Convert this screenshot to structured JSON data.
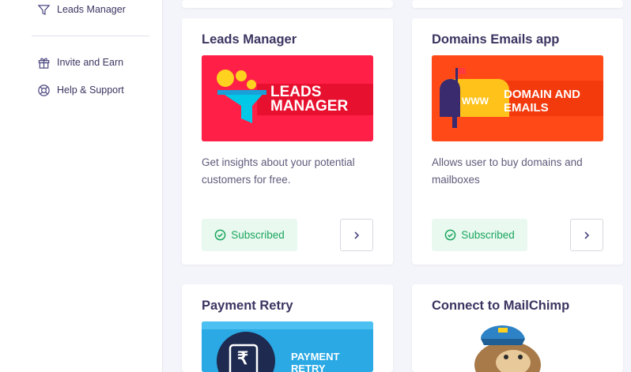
{
  "sidebar": {
    "items": [
      {
        "label": "Leads Manager",
        "icon": "funnel-icon"
      },
      {
        "label": "Invite and Earn",
        "icon": "gift-icon"
      },
      {
        "label": "Help & Support",
        "icon": "lifebuoy-icon"
      }
    ]
  },
  "cards": [
    {
      "title": "Leads Manager",
      "banner": {
        "line1": "LEADS",
        "line2": "MANAGER",
        "bg": "#ff1744",
        "accent": "#00bcd4"
      },
      "description": "Get insights about your potential customers for free.",
      "status": "Subscribed"
    },
    {
      "title": "Domains Emails app",
      "banner": {
        "www": "WWW",
        "line1": "DOMAIN AND",
        "line2": "EMAILS",
        "bg": "#ff4a1a"
      },
      "description": "Allows user to buy domains and mailboxes",
      "status": "Subscribed"
    },
    {
      "title": "Payment Retry",
      "banner": {
        "line1": "PAYMENT",
        "line2": "RETRY",
        "symbol": "₹",
        "bg": "#29a9e6"
      }
    },
    {
      "title": "Connect to MailChimp",
      "banner": {
        "bg": "#ffffff"
      }
    }
  ],
  "colors": {
    "success": "#1aa55c",
    "success_bg": "#e9f9f0",
    "text": "#3b3561"
  }
}
